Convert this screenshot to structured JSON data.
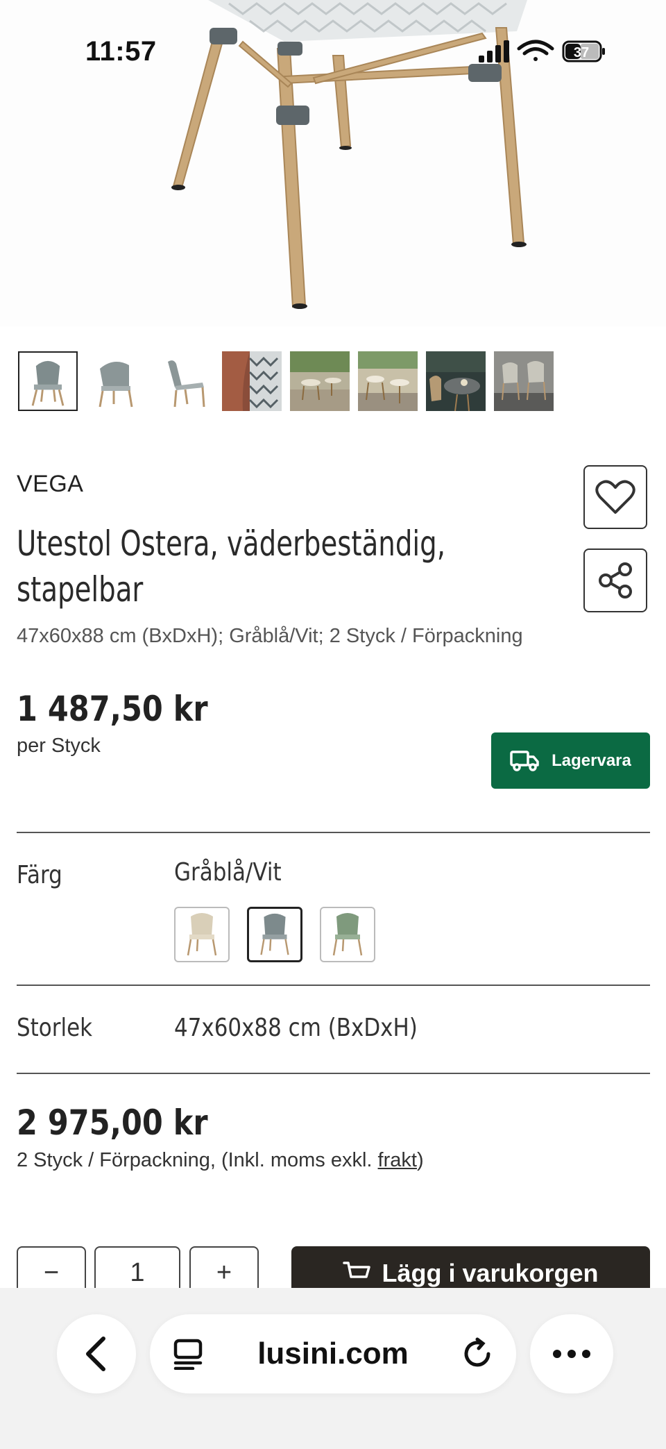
{
  "status": {
    "time": "11:57",
    "battery": "37"
  },
  "product": {
    "brand": "VEGA",
    "title": "Utestol Ostera, väderbeständig, stapelbar",
    "subtitle": "47x60x88 cm (BxDxH); Gråblå/Vit; 2 Styck / Förpackning",
    "price": "1 487,50 kr",
    "price_unit": "per Styck",
    "stock_label": "Lagervara"
  },
  "options": {
    "color_label": "Färg",
    "color_value": "Gråblå/Vit",
    "size_label": "Storlek",
    "size_value": "47x60x88 cm (BxDxH)"
  },
  "summary": {
    "total": "2 975,00 kr",
    "note_prefix": "2 Styck / Förpackning, (Inkl. moms exkl. ",
    "note_link": "frakt",
    "note_suffix": ")"
  },
  "cart": {
    "quantity": "1",
    "minus": "−",
    "plus": "+",
    "add_label": "Lägg i varukorgen"
  },
  "browser": {
    "url": "lusini.com"
  },
  "icons": [
    "heart-icon",
    "share-icon",
    "truck-icon",
    "cart-icon",
    "back-icon",
    "tabs-icon",
    "reload-icon",
    "more-icon"
  ],
  "colors": {
    "stock_green": "#0b6a43",
    "cart_dark": "#2a2622"
  }
}
